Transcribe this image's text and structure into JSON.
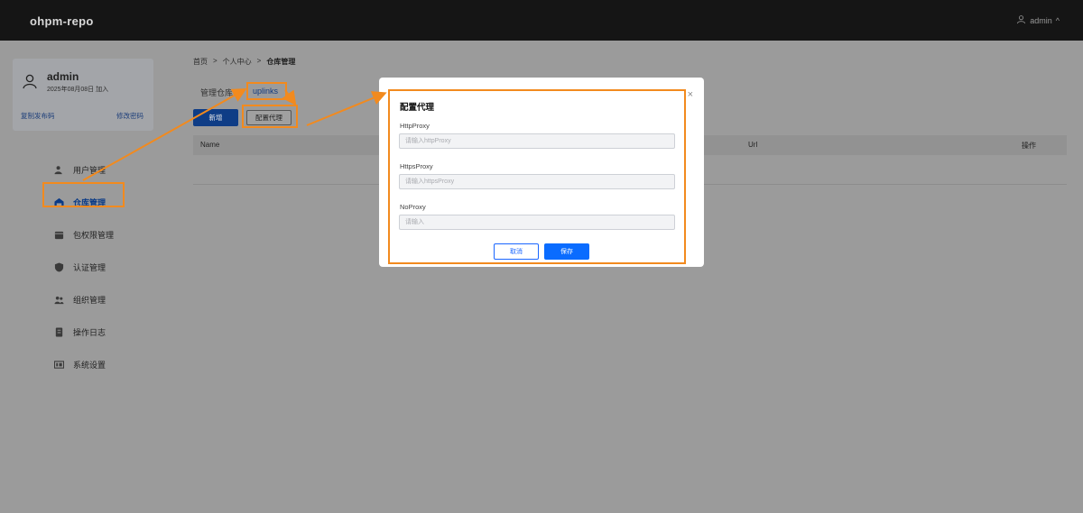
{
  "header": {
    "brand": "ohpm-repo",
    "user": "admin",
    "user_caret": "^"
  },
  "profile": {
    "name": "admin",
    "joined": "2025年08月08日 加入",
    "copy_link": "复制发布码",
    "change_password": "修改密码"
  },
  "sidebar": {
    "items": [
      {
        "label": "用户管理",
        "icon": "user-icon"
      },
      {
        "label": "仓库管理",
        "icon": "warehouse-icon",
        "active": true
      },
      {
        "label": "包权限管理",
        "icon": "package-icon"
      },
      {
        "label": "认证管理",
        "icon": "shield-icon"
      },
      {
        "label": "组织管理",
        "icon": "organization-icon"
      },
      {
        "label": "操作日志",
        "icon": "log-icon"
      },
      {
        "label": "系统设置",
        "icon": "settings-icon"
      }
    ]
  },
  "breadcrumb": {
    "items": [
      "首页",
      "个人中心",
      "仓库管理"
    ],
    "separator": ">"
  },
  "tabs": {
    "manage": "管理仓库",
    "uplinks": "uplinks"
  },
  "toolbar": {
    "new_label": "新增",
    "proxy_label": "配置代理"
  },
  "table": {
    "columns": [
      "Name",
      "Url",
      "操作"
    ]
  },
  "modal": {
    "title": "配置代理",
    "close": "×",
    "http_label": "HttpProxy",
    "http_placeholder": "请输入httpProxy",
    "https_label": "HttpsProxy",
    "https_placeholder": "请输入httpsProxy",
    "no_label": "NoProxy",
    "no_placeholder": "请输入",
    "cancel": "取消",
    "save": "保存"
  },
  "colors": {
    "annotation": "#f28a1e",
    "primary": "#0a6cff",
    "header_bg": "#151515"
  }
}
